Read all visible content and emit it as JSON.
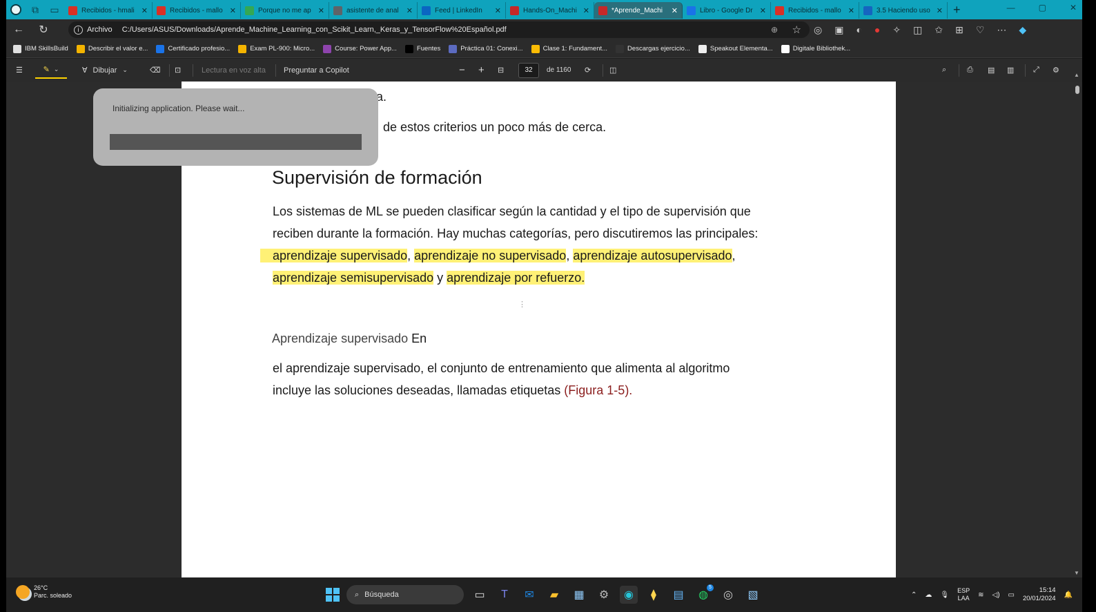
{
  "browser": {
    "tabs": [
      {
        "title": "Recibidos - hmali",
        "color": "#d93025"
      },
      {
        "title": "Recibidos - mallo",
        "color": "#d93025"
      },
      {
        "title": "Porque no me ap",
        "color": "#34a853"
      },
      {
        "title": "asistente de anal",
        "color": "#5f6368"
      },
      {
        "title": "Feed | LinkedIn",
        "color": "#0a66c2"
      },
      {
        "title": "Hands-On_Machi",
        "color": "#c62828"
      },
      {
        "title": "*Aprende_Machi",
        "color": "#c62828",
        "active": true
      },
      {
        "title": "Libro - Google Dr",
        "color": "#1a73e8"
      },
      {
        "title": "Recibidos - mallo",
        "color": "#d93025"
      },
      {
        "title": "3.5 Haciendo uso",
        "color": "#1565c0"
      }
    ],
    "new_tab": "+",
    "address": {
      "label": "Archivo",
      "url": "C:/Users/ASUS/Downloads/Aprende_Machine_Learning_con_Scikit_Learn,_Keras_y_TensorFlow%20Español.pdf"
    },
    "bookmarks": [
      {
        "label": "IBM SkillsBuild",
        "color": "#e0e0e0"
      },
      {
        "label": "Describir el valor e...",
        "color": "#f4b400"
      },
      {
        "label": "Certificado profesio...",
        "color": "#1a73e8"
      },
      {
        "label": "Exam PL-900: Micro...",
        "color": "#f4b400"
      },
      {
        "label": "Course: Power App...",
        "color": "#8e44ad"
      },
      {
        "label": "Fuentes",
        "color": "#000000"
      },
      {
        "label": "Práctica 01: Conexi...",
        "color": "#5c6bc0"
      },
      {
        "label": "Clase 1: Fundament...",
        "color": "#fbbc04"
      },
      {
        "label": "Descargas ejercicio...",
        "color": "#333333"
      },
      {
        "label": "Speakout Elementa...",
        "color": "#eeeeee"
      },
      {
        "label": "Digitale Bibliothek...",
        "color": "#ffffff"
      }
    ]
  },
  "pdf_toolbar": {
    "draw_label": "Dibujar",
    "read_aloud_label": "Lectura en voz alta",
    "copilot_label": "Preguntar a Copilot",
    "page_current": "32",
    "page_total": "de 1160"
  },
  "dialog": {
    "message": "Initializing application. Please wait..."
  },
  "document": {
    "line_top": "a.",
    "line_criteria": "de estos criterios un poco más de cerca.",
    "heading": "Supervisión de formación",
    "para1_line1": "Los sistemas de ML se pueden clasificar según la cantidad y el tipo de supervisión que",
    "para1_line2": "reciben durante la formación. Hay muchas categorías, pero discutiremos las principales:",
    "hl1": "aprendizaje supervisado",
    "comma1": ",",
    "hl2": "aprendizaje no supervisado",
    "comma2": ",",
    "hl3": "aprendizaje autosupervisado",
    "comma3": ",",
    "hl4": "aprendizaje semisupervisado",
    "y": "y",
    "hl5": "aprendizaje por refuerzo.",
    "subheading": "Aprendizaje supervisado",
    "subheading_en": "En",
    "para2_line1": "el aprendizaje supervisado, el conjunto de entrenamiento que alimenta al algoritmo",
    "para2_line2": "incluye las soluciones deseadas, llamadas etiquetas",
    "figure_ref": "(Figura 1-5)."
  },
  "taskbar": {
    "temp": "26°C",
    "weather": "Parc. soleado",
    "search_label": "Búsqueda",
    "lang1": "ESP",
    "lang2": "LAA",
    "time": "15:14",
    "date": "20/01/2024",
    "badge": "5"
  },
  "colors": {
    "tabbar": "#0fa3bd",
    "highlight": "#fff176",
    "figure_ref": "#8b1e1e"
  }
}
